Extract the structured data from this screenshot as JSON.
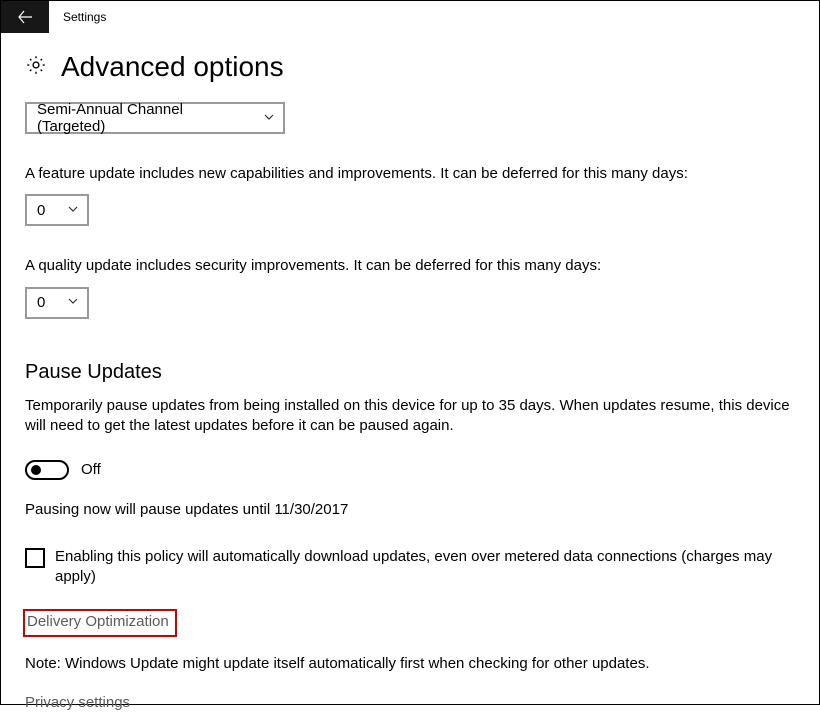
{
  "header": {
    "app_title": "Settings"
  },
  "page": {
    "title": "Advanced options"
  },
  "channel": {
    "selected": "Semi-Annual Channel (Targeted)"
  },
  "feature_update": {
    "description": "A feature update includes new capabilities and improvements. It can be deferred for this many days:",
    "value": "0"
  },
  "quality_update": {
    "description": "A quality update includes security improvements. It can be deferred for this many days:",
    "value": "0"
  },
  "pause": {
    "title": "Pause Updates",
    "description": "Temporarily pause updates from being installed on this device for up to 35 days. When updates resume, this device will need to get the latest updates before it can be paused again.",
    "toggle_label": "Off",
    "note": "Pausing now will pause updates until 11/30/2017"
  },
  "metered": {
    "label": "Enabling this policy will automatically download updates, even over metered data connections (charges may apply)"
  },
  "links": {
    "delivery_optimization": "Delivery Optimization",
    "privacy_settings": "Privacy settings"
  },
  "note": "Note: Windows Update might update itself automatically first when checking for other updates."
}
